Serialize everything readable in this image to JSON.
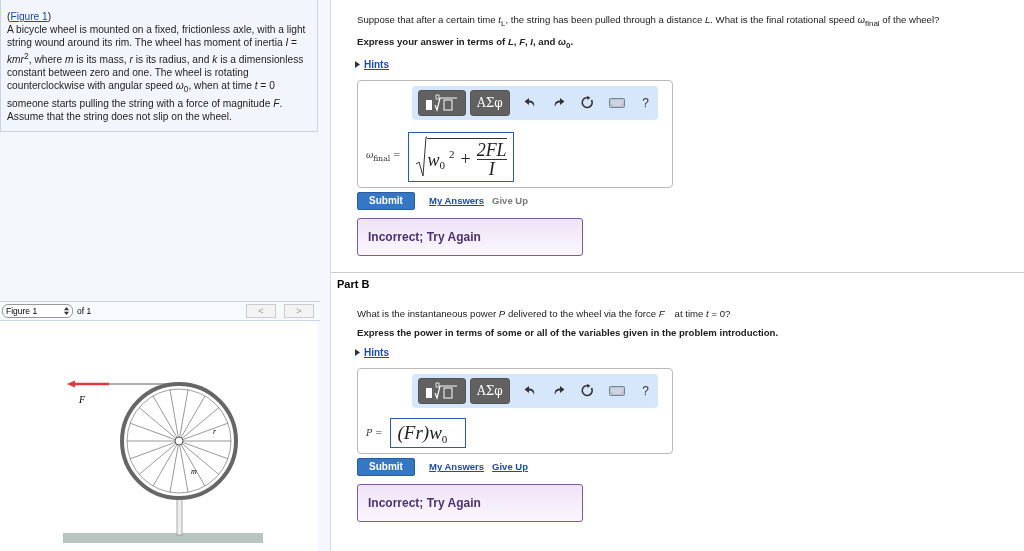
{
  "intro": {
    "open": "(",
    "figure_link": "Figure 1",
    "close": ")",
    "text": "A bicycle wheel is mounted on a fixed, frictionless axle, with a light string wound around its rim. The wheel has moment of inertia *I* = *kmr*$^{2}$, where *m* is its mass, *r* is its radius, and *k* is a dimensionless constant between zero and one. The wheel is rotating counterclockwise with angular speed *ω*$_{0}$, when at time *t* = 0 someone starts pulling the string with a force of magnitude *F*. Assume that the string does not slip on the wheel."
  },
  "figure": {
    "select": "Figure 1",
    "count": "of 1",
    "prev": "<",
    "next": ">",
    "labels": {
      "force": "F",
      "radius": "r",
      "mass": "m"
    }
  },
  "parts": [
    {
      "question": "Suppose that after a certain time *t*$_{L}$, the string has been pulled through a distance *L*. What is the final rotational speed *ω*$_{final}$ of the wheel?",
      "instruction": "Express your answer in terms of *L*, *F*, *I*, and *ω*$_{0}$.",
      "hints": "Hints",
      "toolbar": {
        "symbols": "ΑΣφ",
        "help": "?"
      },
      "variable": "*ω*$_{final}$ =",
      "answer": {
        "kind": "sqrt",
        "base": "w",
        "sub": "0",
        "sup": "2",
        "op": "+",
        "numerator": "2FL",
        "denominator": "I"
      },
      "submit": "Submit",
      "my_answers": "My Answers",
      "give_up": {
        "label": "Give Up",
        "disabled": true
      },
      "feedback": "Incorrect; Try Again"
    },
    {
      "heading": "Part B",
      "question": "What is the instantaneous power *P* delivered to the wheel via the force *F⃗* at time *t* = 0?",
      "instruction": "Express the power in terms of some or all of the variables given in the problem introduction.",
      "hints": "Hints",
      "toolbar": {
        "symbols": "ΑΣφ",
        "help": "?"
      },
      "variable": "*P* =",
      "answer": {
        "kind": "product",
        "text": "(Fr)",
        "base": "w",
        "sub": "0"
      },
      "submit": "Submit",
      "my_answers": "My Answers",
      "give_up": {
        "label": "Give Up",
        "disabled": false
      },
      "feedback": "Incorrect; Try Again"
    }
  ]
}
